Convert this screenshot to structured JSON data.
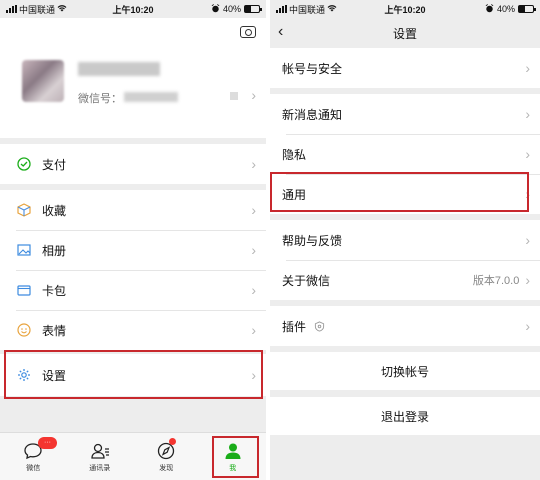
{
  "status_left": {
    "carrier": "中国联通",
    "time": "上午10:20",
    "battery": "40%"
  },
  "status_right": {
    "carrier": "中国联通",
    "time": "上午10:20",
    "battery": "40%"
  },
  "profile": {
    "wechat_id_label": "微信号："
  },
  "me_menu": {
    "pay": "支付",
    "favorites": "收藏",
    "album": "相册",
    "cards": "卡包",
    "stickers": "表情",
    "settings": "设置"
  },
  "tabbar": {
    "chats": "微信",
    "contacts": "通讯录",
    "discover": "发现",
    "me": "我",
    "chats_badge": "···"
  },
  "settings_page": {
    "title": "设置",
    "account_security": "帐号与安全",
    "new_message_notify": "新消息通知",
    "privacy": "隐私",
    "general": "通用",
    "help_feedback": "帮助与反馈",
    "about": "关于微信",
    "version": "版本7.0.0",
    "plugins": "插件",
    "switch_account": "切换帐号",
    "logout": "退出登录"
  },
  "colors": {
    "accent": "#1aad19",
    "highlight": "#c8282d",
    "badge": "#f43530"
  }
}
